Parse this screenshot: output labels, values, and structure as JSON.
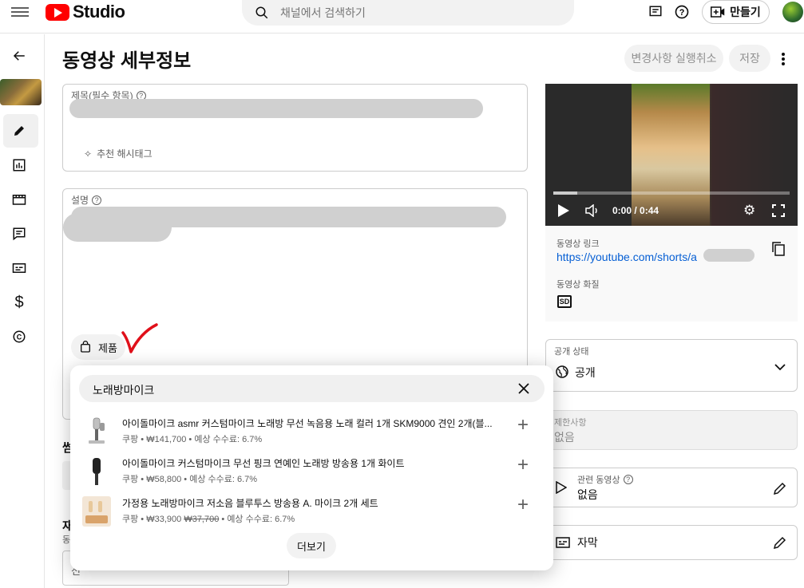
{
  "topbar": {
    "logo_text": "Studio",
    "search_placeholder": "채널에서 검색하기",
    "create_label": "만들기"
  },
  "page": {
    "title": "동영상 세부정보",
    "undo_label": "변경사항 실행취소",
    "save_label": "저장"
  },
  "details": {
    "title_label": "제목(필수 항목)",
    "hashtag_label": "추천 해시태그",
    "description_label": "설명",
    "products_label": "제품",
    "thumbnail_partial": "썸",
    "playlist_partial": "재",
    "playlist_sub_partial": "동",
    "select_partial": "선"
  },
  "product_popup": {
    "query": "노래방마이크",
    "items": [
      {
        "title": "아이돌마이크 asmr 커스텀마이크 노래방 무선 녹음용 노래 컬러 1개 SKM9000 견인 2개(블...",
        "store": "쿠팡",
        "price": "₩141,700",
        "commission": "예상 수수료: 6.7%",
        "add_icon": "plus-icon"
      },
      {
        "title": "아이돌마이크 커스텀마이크 무선 핑크 연예인 노래방 방송용 1개 화이트",
        "store": "쿠팡",
        "price": "₩58,800",
        "commission": "예상 수수료: 6.7%",
        "add_icon": "plus-icon"
      },
      {
        "title": "가정용 노래방마이크 저소음 블루투스 방송용 A. 마이크 2개 세트",
        "store": "쿠팡",
        "price": "₩33,900",
        "original_price": "₩37,700",
        "commission": "예상 수수료: 6.7%",
        "add_icon": "plus-icon"
      }
    ],
    "more_label": "더보기"
  },
  "video": {
    "time": "0:00 / 0:44",
    "link_label": "동영상 링크",
    "link_url": "https://youtube.com/shorts/a",
    "quality_label": "동영상 화질",
    "quality_badge": "SD",
    "progress": 0.1
  },
  "visibility": {
    "label": "공개 상태",
    "value": "공개"
  },
  "restrictions": {
    "label": "제한사항",
    "value": "없음"
  },
  "related_video": {
    "label": "관련 동영상",
    "value": "없음"
  },
  "subtitles": {
    "label": "자막"
  },
  "colors": {
    "accent_red": "#ff0000",
    "link_blue": "#065fd4",
    "check_red": "#e0101a"
  }
}
